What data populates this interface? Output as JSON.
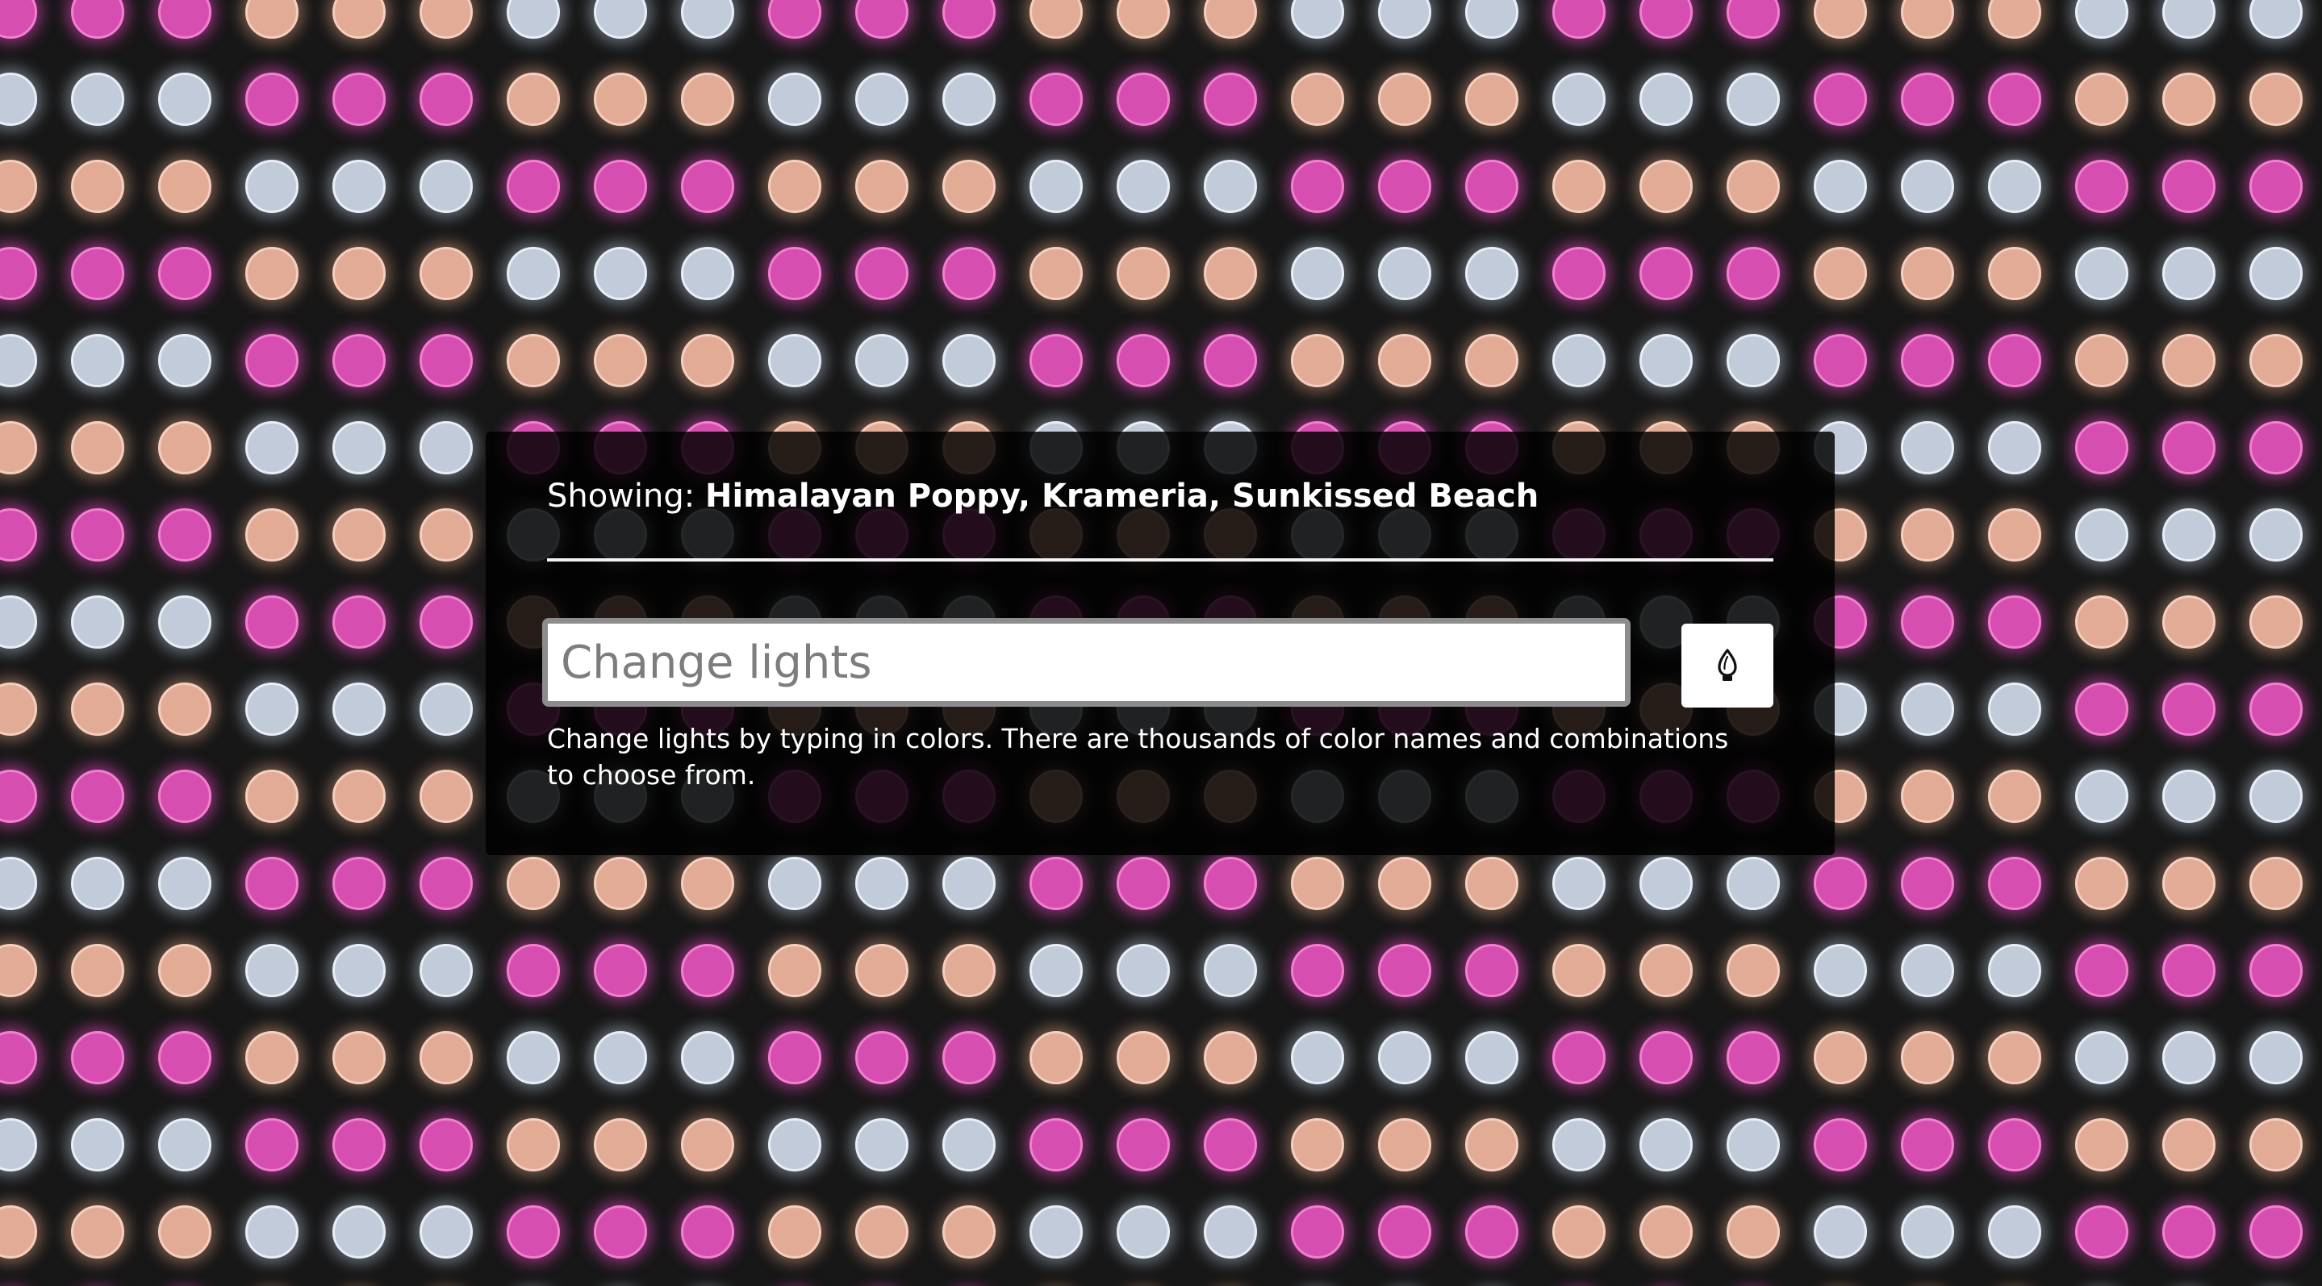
{
  "app": {
    "showing_prefix": "Showing:",
    "showing_names": "Himalayan Poppy, Krameria, Sunkissed Beach"
  },
  "palette": {
    "background": "#171717",
    "colors": [
      {
        "name": "pink",
        "fill": "#d64eb0",
        "rim": "#f27fd0",
        "glow": "rgba(230,70,190,0.55)"
      },
      {
        "name": "peach",
        "fill": "#e2ab96",
        "rim": "#f6cebd",
        "glow": "rgba(235,170,140,0.45)"
      },
      {
        "name": "silver",
        "fill": "#c2cbda",
        "rim": "#e8eef6",
        "glow": "rgba(200,215,235,0.45)"
      }
    ]
  },
  "form": {
    "input_placeholder": "Change lights",
    "input_value": "",
    "submit_icon": "lightbulb-icon",
    "help_text": "Change lights by typing in colors. There are thousands of color names and combinations to choose from."
  }
}
